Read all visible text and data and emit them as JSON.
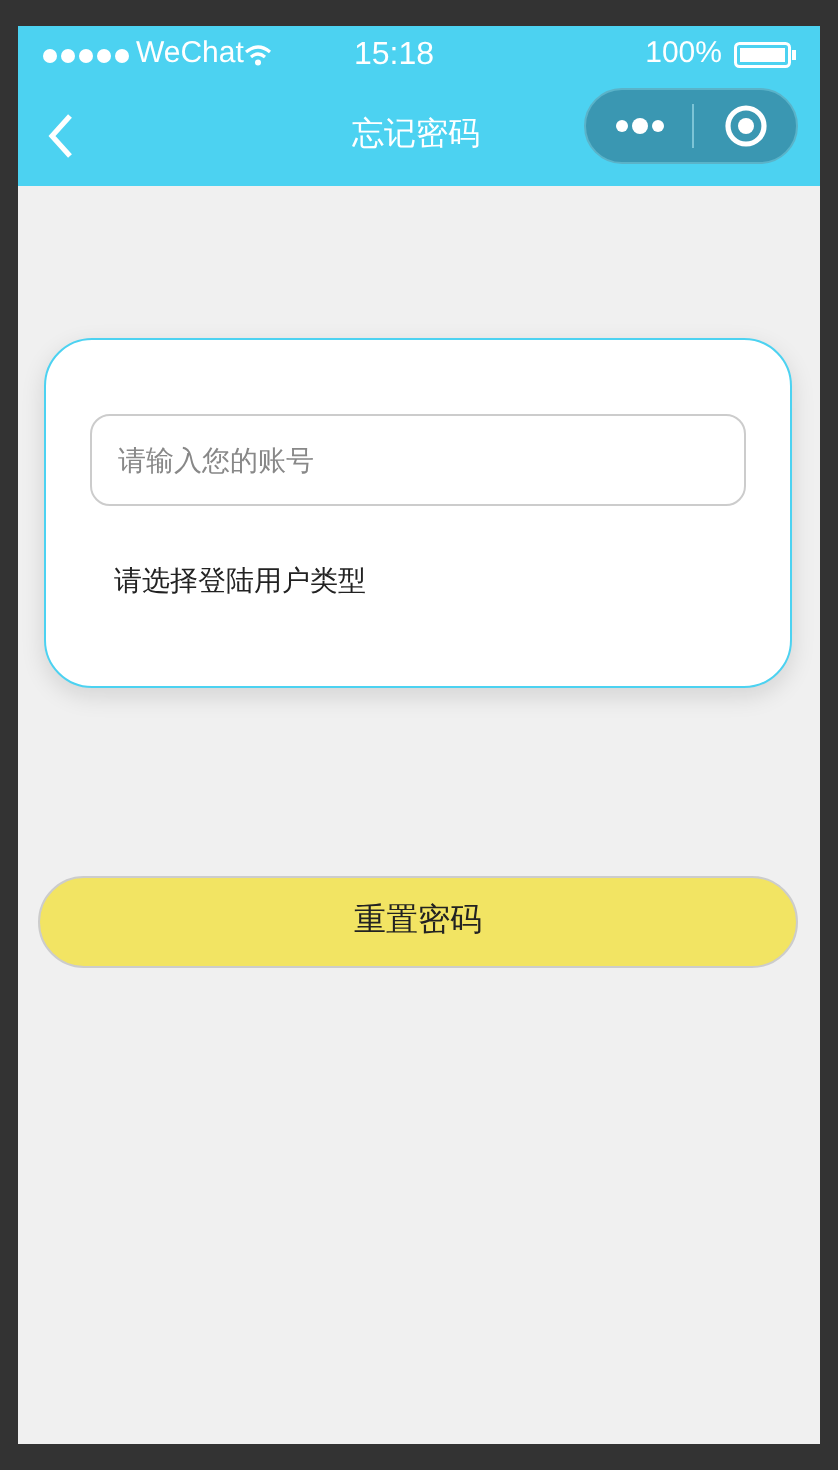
{
  "status_bar": {
    "carrier": "WeChat",
    "time": "15:18",
    "battery": "100%"
  },
  "nav_bar": {
    "title": "忘记密码"
  },
  "form": {
    "account_field": {
      "placeholder": "请输入您的账号"
    },
    "user_type_prompt": "请选择登陆用户类型"
  },
  "reset_button": {
    "label": "重置密码"
  }
}
